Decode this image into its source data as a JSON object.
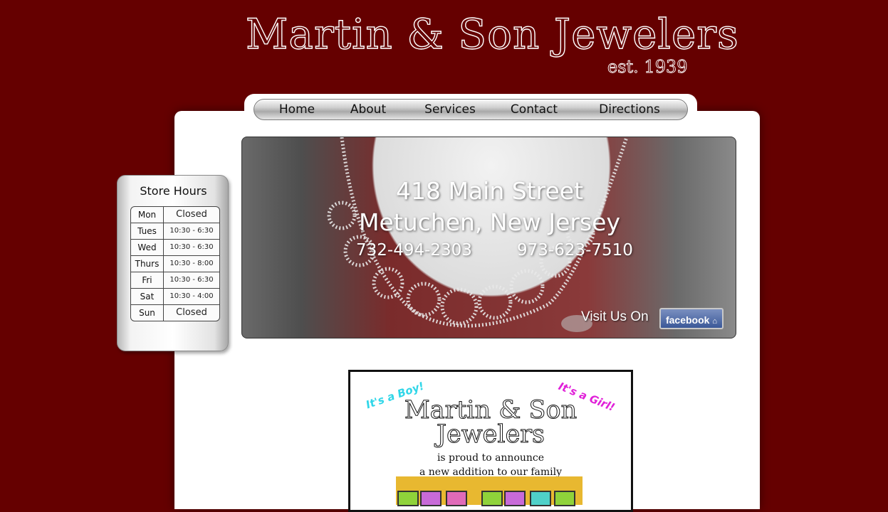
{
  "header": {
    "title": "Martin & Son Jewelers",
    "established": "est. 1939"
  },
  "nav": {
    "items": [
      "Home",
      "About",
      "Services",
      "Contact",
      "Directions"
    ]
  },
  "store_hours": {
    "title": "Store Hours",
    "rows": [
      {
        "day": "Mon",
        "hours": "Closed"
      },
      {
        "day": "Tues",
        "hours": "10:30 - 6:30"
      },
      {
        "day": "Wed",
        "hours": "10:30 - 6:30"
      },
      {
        "day": "Thurs",
        "hours": "10:30 - 8:00"
      },
      {
        "day": "Fri",
        "hours": "10:30 - 6:30"
      },
      {
        "day": "Sat",
        "hours": "10:30 - 4:00"
      },
      {
        "day": "Sun",
        "hours": "Closed"
      }
    ]
  },
  "hero": {
    "street": "418 Main Street",
    "city": "Metuchen, New Jersey",
    "phone_1": "732-494-2303",
    "phone_2": "973-623-7510",
    "facebook_text": "Visit Us On",
    "facebook_button": "facebook"
  },
  "announcement": {
    "boy": "It's a Boy!",
    "girl": "It's a Girl!",
    "name_line1": "Martin & Son",
    "name_line2": "Jewelers",
    "text_line1": "is proud to announce",
    "text_line2": "a new addition to our family"
  },
  "colors": {
    "background": "#650000",
    "panel": "#ffffff",
    "facebook": "#3b5998"
  }
}
